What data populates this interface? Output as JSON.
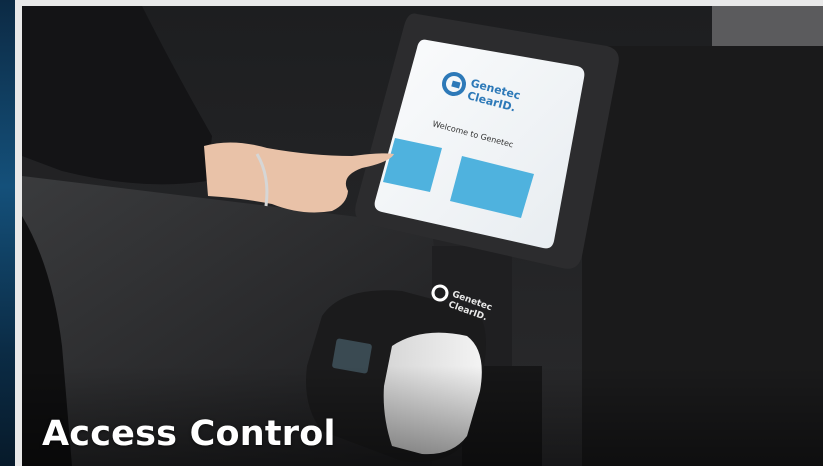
{
  "card": {
    "caption": "Access Control"
  },
  "screen_logo": {
    "line1": "Genetec",
    "line2": "ClearID."
  },
  "screen_welcome": "Welcome to Genetec",
  "printer_logo": {
    "line1": "Genetec",
    "line2": "ClearID."
  },
  "colors": {
    "screen_button": "#4fb2de",
    "logo_blue": "#2d79b8",
    "kiosk_frame": "#2c2c2e",
    "caption_text": "#ffffff"
  }
}
